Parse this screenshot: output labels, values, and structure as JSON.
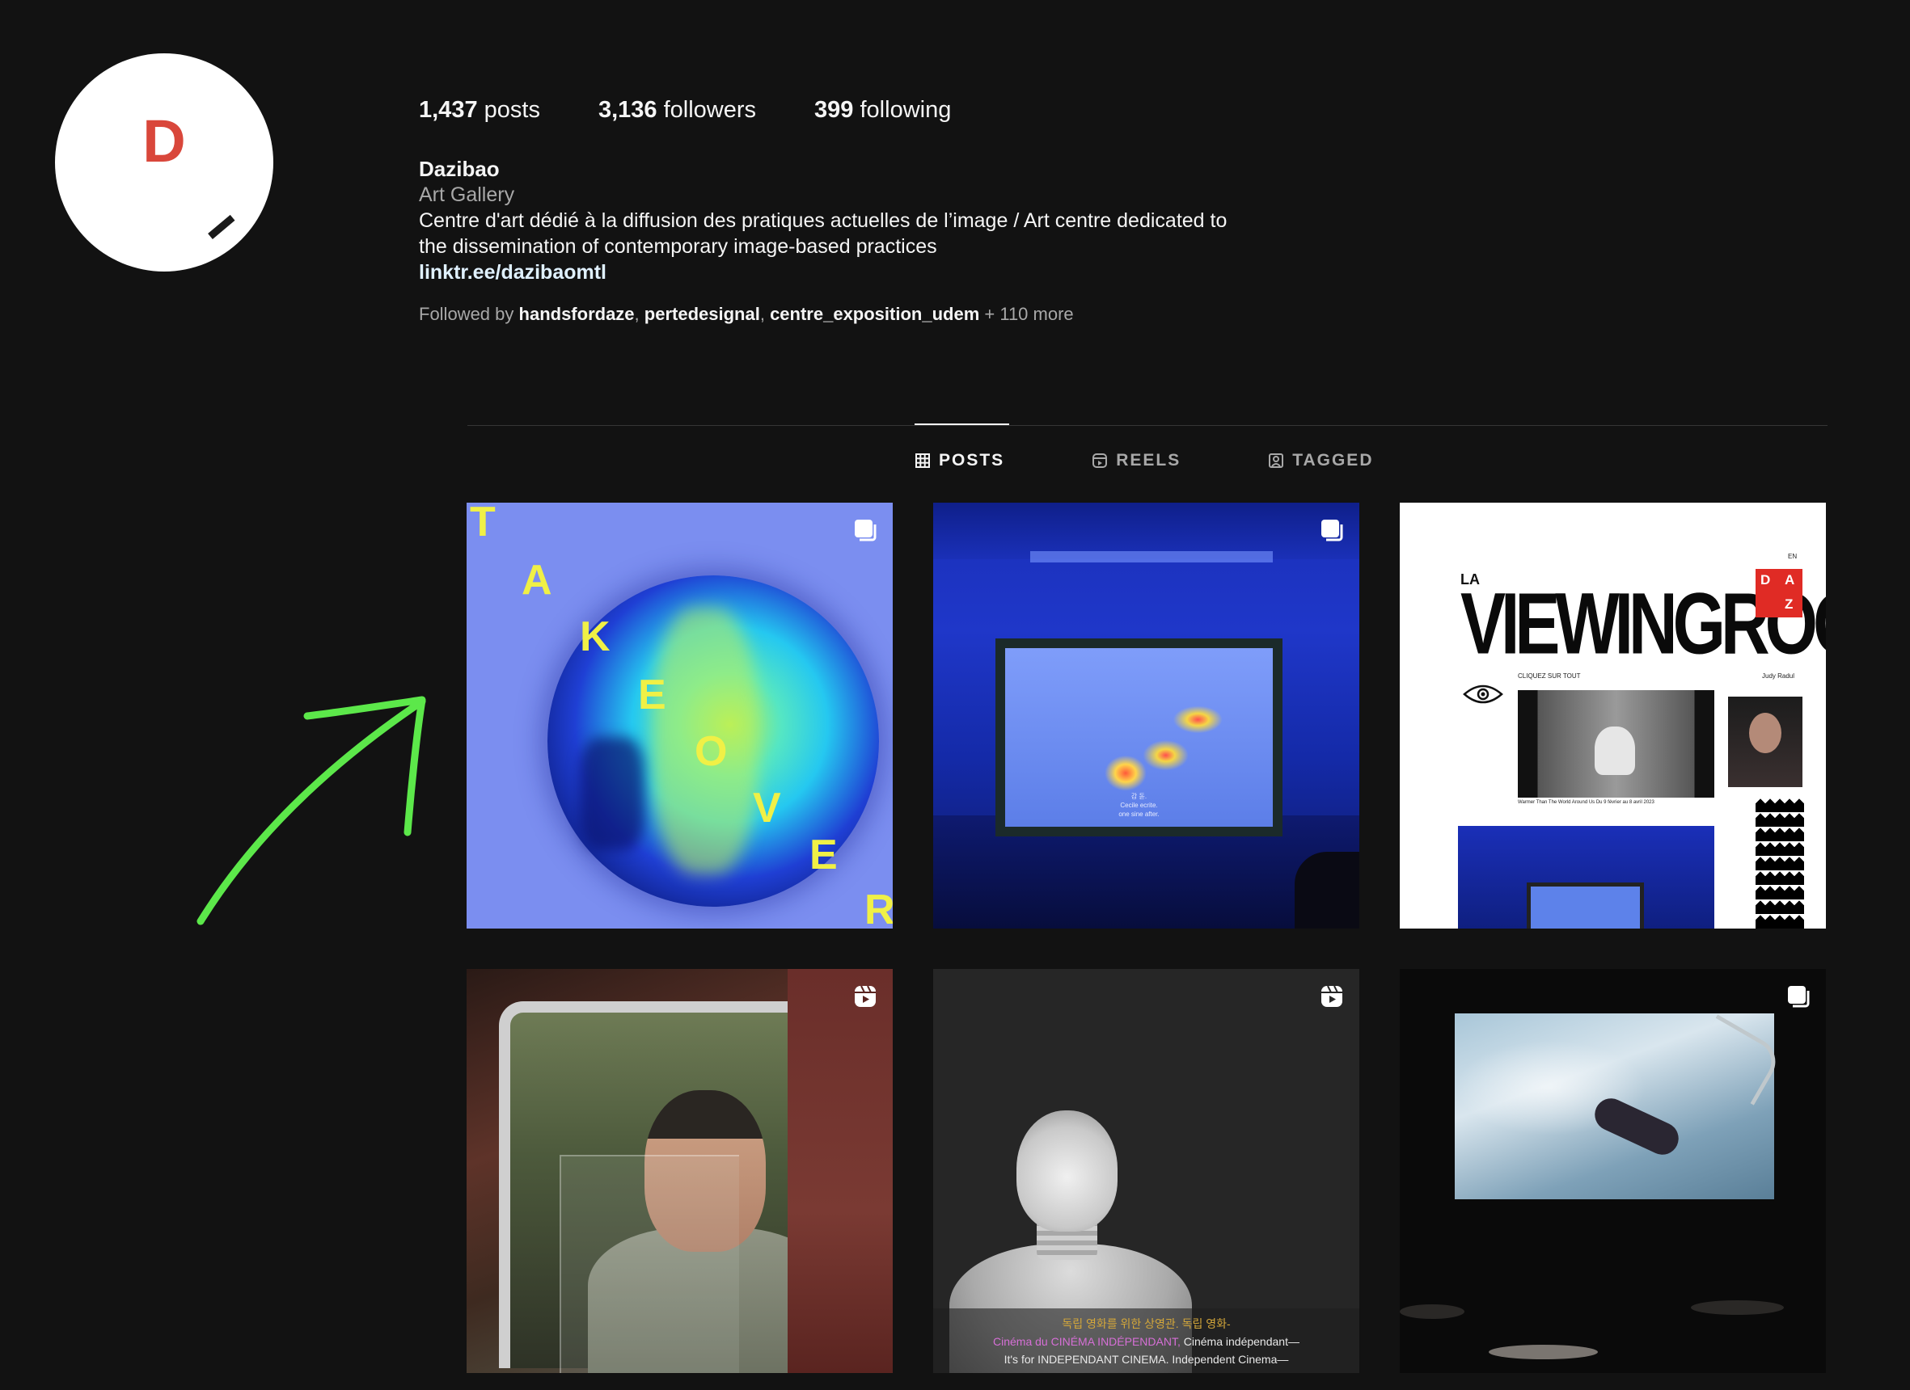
{
  "profile": {
    "logo_letter": "D",
    "stats": [
      {
        "count": "1,437",
        "label": "posts"
      },
      {
        "count": "3,136",
        "label": "followers"
      },
      {
        "count": "399",
        "label": "following"
      }
    ],
    "name": "Dazibao",
    "category": "Art Gallery",
    "bio_line1": "Centre d'art dédié à la diffusion des pratiques actuelles de l’image / Art centre dedicated to",
    "bio_line2": "the dissemination of contemporary image-based practices",
    "link": "linktr.ee/dazibaomtl",
    "followed_prefix": "Followed by",
    "followed_users": [
      "handsfordaze",
      "pertedesignal",
      "centre_exposition_udem"
    ],
    "followed_more": "+ 110 more"
  },
  "tabs": [
    {
      "label": "POSTS",
      "icon": "grid-icon",
      "active": true
    },
    {
      "label": "REELS",
      "icon": "reels-icon",
      "active": false
    },
    {
      "label": "TAGGED",
      "icon": "tagged-icon",
      "active": false
    }
  ],
  "posts": [
    {
      "type": "carousel",
      "icon": "carousel-icon",
      "letters": [
        "T",
        "A",
        "K",
        "E",
        "O",
        "V",
        "E",
        "R"
      ]
    },
    {
      "type": "carousel",
      "icon": "carousel-icon",
      "screen_text": [
        "감 돋.",
        "Cecile ecrite.",
        "one sine after."
      ]
    },
    {
      "type": "carousel",
      "icon": "carousel-icon",
      "la": "LA",
      "title": "VIEWINGROOM",
      "daz_letters": [
        "D",
        "A",
        "Z"
      ],
      "small_clique": "CLIQUEZ SUR TOUT",
      "small_name": "Judy Radul",
      "small_caption": "Warmer Than The World Around Us Du 9 février au 8 avril 2023",
      "small_en": "EN"
    },
    {
      "type": "reel",
      "icon": "reels-icon"
    },
    {
      "type": "reel",
      "icon": "reels-icon",
      "sub_ko": "독립 영화를 위한 상영관. 독립 영화-",
      "sub_fr_pink": "Cinéma du CINÉMA INDÉPENDANT,",
      "sub_fr": " Cinéma indépendant—",
      "sub_en": "It's for INDEPENDANT CINEMA. Independent Cinema—"
    },
    {
      "type": "carousel",
      "icon": "carousel-icon"
    }
  ],
  "colors": {
    "background": "#121212",
    "logo_red": "#d9473b",
    "annotation_arrow": "#5ce84a",
    "takeover_yellow": "#f0f046"
  }
}
